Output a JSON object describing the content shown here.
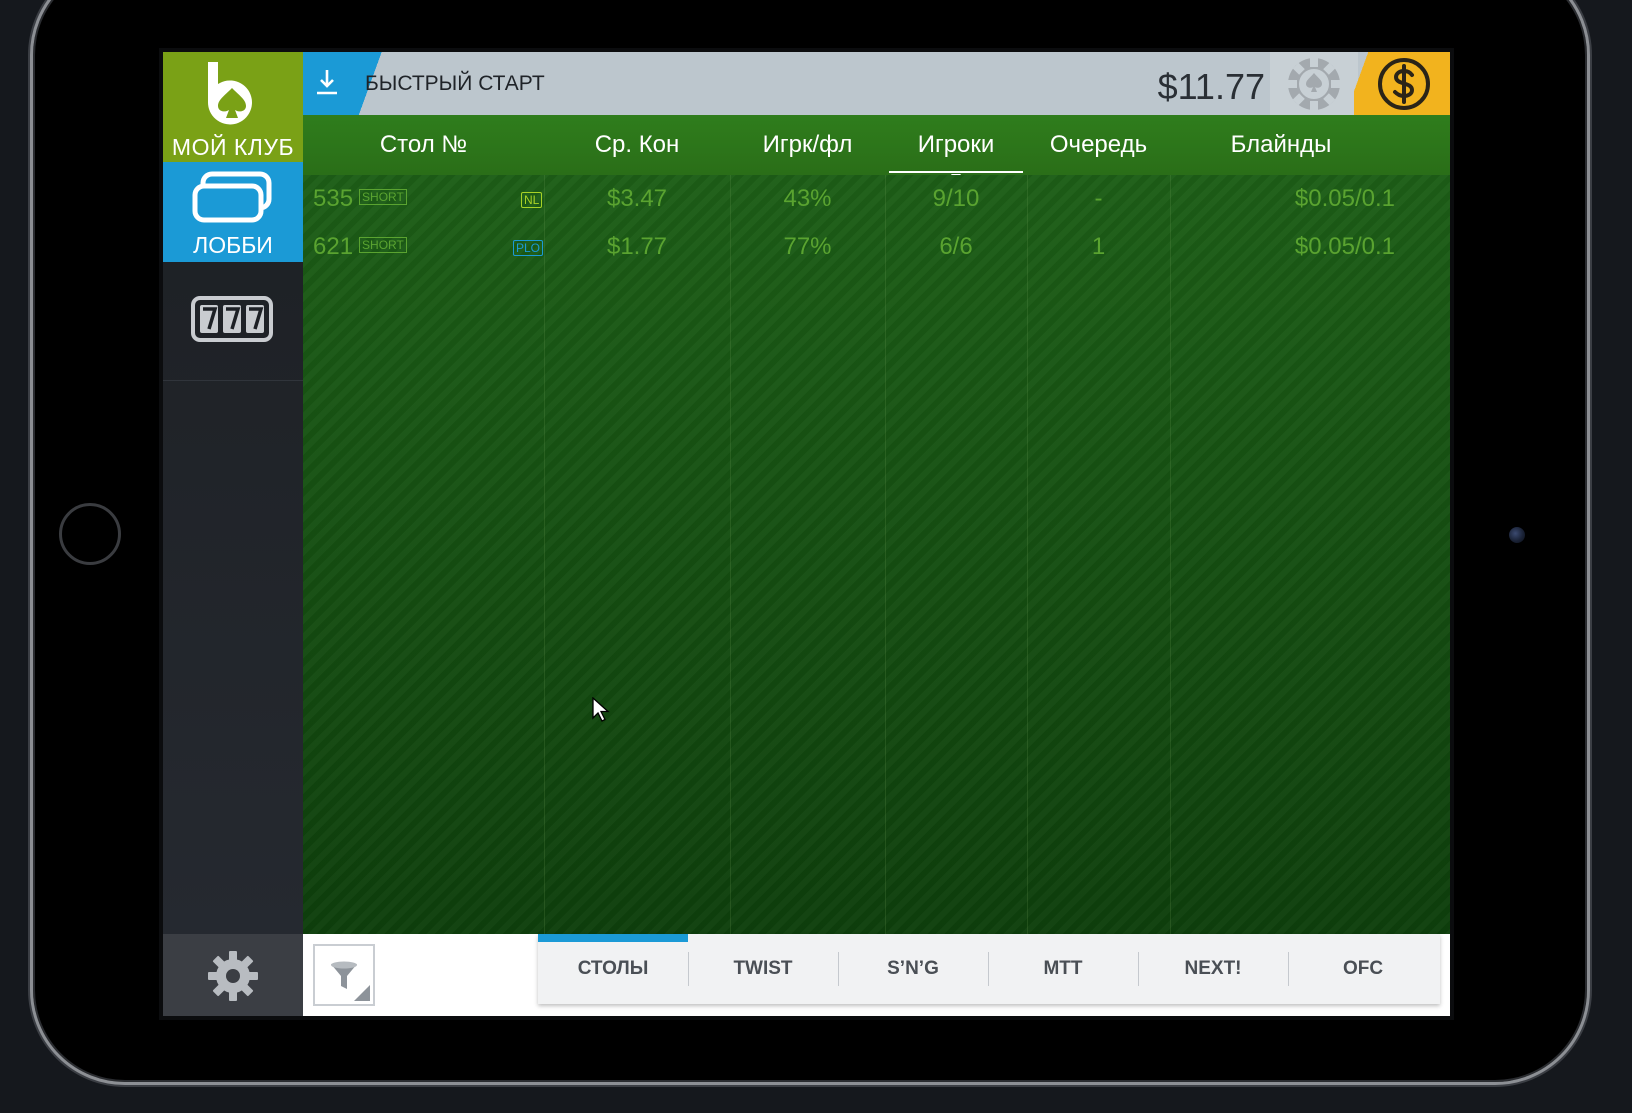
{
  "sidebar": {
    "club_label": "МОЙ КЛУБ",
    "lobby_label": "ЛОББИ",
    "slots_icon": "777-slots-icon",
    "settings_icon": "gear-icon"
  },
  "topbar": {
    "quick_start_label": "БЫСТРЫЙ СТАРТ",
    "balance": "$11.77",
    "chip_icon": "poker-chip-icon",
    "cash_icon": "dollar-icon"
  },
  "table": {
    "columns": [
      "Стол №",
      "Ср. Кон",
      "Игрк/фл",
      "Игроки",
      "Очередь",
      "Блайнды"
    ],
    "sorted_column": "Игроки",
    "rows": [
      {
        "table_no": "535",
        "tag": "SHORT",
        "game": "NL",
        "avg_pot": "$3.47",
        "players_flop": "43%",
        "players": "9/10",
        "queue": "-",
        "blinds": "$0.05/0.1"
      },
      {
        "table_no": "621",
        "tag": "SHORT",
        "game": "PLO",
        "avg_pot": "$1.77",
        "players_flop": "77%",
        "players": "6/6",
        "queue": "1",
        "blinds": "$0.05/0.1"
      }
    ]
  },
  "bottom": {
    "filter_icon": "filter-icon",
    "tabs": [
      "СТОЛЫ",
      "TWIST",
      "S’N’G",
      "MTT",
      "NEXT!",
      "OFC"
    ],
    "active_tab": "СТОЛЫ"
  },
  "colors": {
    "accent_blue": "#1b9ad6",
    "club_green": "#7aa116",
    "header_green": "#2f7d1c",
    "cash_yellow": "#f2b31e",
    "row_text": "#5aa330",
    "plo_tag": "#1b9ad6"
  }
}
